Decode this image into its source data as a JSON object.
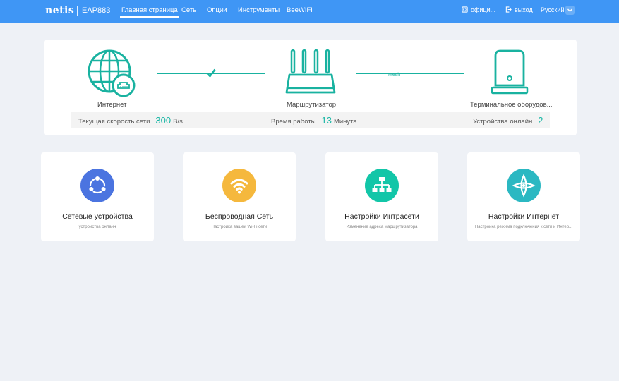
{
  "header": {
    "brand": "netis",
    "model": "EAP883",
    "nav": [
      {
        "label": "Главная страница",
        "active": true
      },
      {
        "label": "Сеть"
      },
      {
        "label": "Опции"
      },
      {
        "label": "Инструменты"
      },
      {
        "label": "BeeWIFI"
      }
    ],
    "official_label": "офици...",
    "logout_label": "выход",
    "language": "Русский",
    "bar_color": "#3f96f5"
  },
  "status": {
    "devices": [
      {
        "label": "Интернет",
        "icon": "globe-icon"
      },
      {
        "label": "Маршрутизатор",
        "icon": "router-icon"
      },
      {
        "label": "Терминальное оборудов...",
        "icon": "terminal-device-icon"
      }
    ],
    "mesh_label": "Mesh",
    "connected": true,
    "speed_label": "Текущая скорость сети",
    "speed_value": "300",
    "speed_unit": "B/s",
    "uptime_label": "Время работы",
    "uptime_value": "13",
    "uptime_unit": "Минута",
    "online_label": "Устройства онлайн",
    "online_value": "2",
    "accent_color": "#1bb7a6"
  },
  "cards": [
    {
      "title": "Сетевые устройства",
      "subtitle": "устройства онлайн",
      "icon": "share-icon",
      "color": "#4b74e0"
    },
    {
      "title": "Беспроводная Сеть",
      "subtitle": "Настройка вашей Wi-Fi сети",
      "icon": "wifi-icon",
      "color": "#f5b83d"
    },
    {
      "title": "Настройки Интрасети",
      "subtitle": "Изменение адреса маршрутизатора",
      "icon": "lan-icon",
      "color": "#12c6a8"
    },
    {
      "title": "Настройки Интернет",
      "subtitle": "Настройка режима подключения к сети и Интер...",
      "icon": "internet-settings-icon",
      "color": "#2bb8c2"
    }
  ]
}
